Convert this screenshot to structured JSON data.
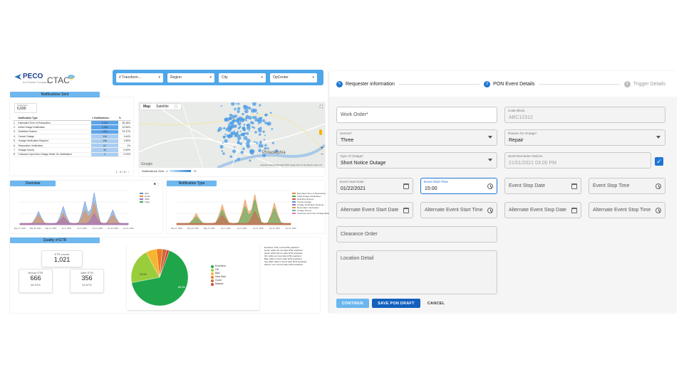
{
  "dashboard": {
    "brand": {
      "peco": "PECO",
      "peco_sub": "An Exelon Company",
      "ctac": "CTAC"
    },
    "filters": [
      "# Transform...",
      "Region",
      "City",
      "OpCenter"
    ],
    "notifications_sent": {
      "title": "Notifications Sent",
      "count_label": "Customers",
      "count_value": "6,690",
      "headers": [
        "",
        "Notification Type",
        "# Notifications ↑",
        "%"
      ],
      "rows": [
        {
          "n": "1.",
          "type": "Estimated Time of Restoration",
          "count": "2,371",
          "pct": "35.48%"
        },
        {
          "n": "2.",
          "type": "Initial Outage Notification",
          "count": "1,515",
          "pct": "22.66%"
        },
        {
          "n": "3.",
          "type": "Definitive Restore",
          "count": "1,571",
          "pct": "23.47%"
        },
        {
          "n": "4.",
          "type": "Cancel Outage",
          "count": "116",
          "pct": "1.64%"
        },
        {
          "n": "5.",
          "type": "Outage Verification Request",
          "count": "106",
          "pct": "1.59%"
        },
        {
          "n": "6.",
          "type": "Restoration Verification",
          "count": "61",
          "pct": "1%"
        },
        {
          "n": "7.",
          "type": "Outage Survey",
          "count": "40",
          "pct": "0.59%"
        },
        {
          "n": "8.",
          "type": "Customer Input Non-Outage Meter On Notification",
          "count": "2",
          "pct": "0.03%"
        }
      ],
      "pager": "1 - 8 / 8"
    },
    "map": {
      "tabs": [
        "Map",
        "Satellite"
      ],
      "legend_label": "Notifications Sent",
      "legend_min": "1",
      "legend_max": "71",
      "place": "Philadelphia",
      "footer": "Keyboard shortcuts   Map data ©2021 Google   Terms of Use   Report a map error"
    },
    "overview": {
      "title": "Overview",
      "legend": [
        "Alert",
        "Email",
        "SMS",
        "Voice"
      ],
      "dates": [
        "May 17, 2020",
        "May 22, 2020",
        "May 27, 2020",
        "Jun 1, 2020",
        "Jun 6, 2020",
        "Jun 11, 2020",
        "Jun 16, 2020",
        "Jun 21, 2020"
      ]
    },
    "notification_type": {
      "title": "Notification Type",
      "legend": [
        "Estimated Time of Restoration",
        "Initial Outage Notification",
        "Definitive Restore",
        "Cancel Outage",
        "Outage Verification Request",
        "Restoration Verification",
        "Outage Survey",
        "Customer Input Non-Outage Meter On Notification"
      ],
      "dates": [
        "May 17, 2020",
        "May 22, 2020",
        "May 27, 2020",
        "Jun 1, 2020",
        "Jun 6, 2020",
        "Jun 11, 2020",
        "Jun 16, 2020",
        "Jun 21, 2020"
      ]
    },
    "etr_quality": {
      "title": "Quality of ETR",
      "etr_count_label": "ETR counts",
      "etr_count": "1,021",
      "before_label": "Before ETR",
      "before_value": "666",
      "before_pct": "65.23%",
      "after_label": "After ETR",
      "after_value": "356",
      "after_pct": "34.87%",
      "pie_labels": [
        "Excellent",
        "OK",
        "Bad",
        "Very Bad",
        "Good",
        "Missed"
      ],
      "pie_colors": [
        "#1fa64a",
        "#9acd3c",
        "#f5b52e",
        "#f07a1f",
        "#c96b3a",
        "#d84532"
      ],
      "pie_text_major": "66.4%",
      "pie_text_second": "20.2%",
      "notes": [
        "Excellent: Prior to the ETR predicted",
        "Great: within 15 min after ETR predicted",
        "Good: within 30 min after ETR predicted",
        "OK: within an hour after ETR predicted",
        "Bad: within 2 hours after ETR predicted",
        "Very Bad: within 4 hours after ETR predicted",
        "Worse: over 4 hours after ETR predicted"
      ]
    }
  },
  "form": {
    "steps": [
      {
        "label": "Requester information",
        "state": "done"
      },
      {
        "label": "PON Event Details",
        "state": "active",
        "num": "2"
      },
      {
        "label": "Trigger Details",
        "state": "inactive",
        "num": "3"
      }
    ],
    "fields": {
      "work_order": {
        "placeholder": "Work Order*"
      },
      "code_block": {
        "label": "Code Block",
        "value": "ABC12312"
      },
      "service": {
        "label": "Service*",
        "value": "Three"
      },
      "reason": {
        "label": "Reason for Outage*",
        "value": "Repair"
      },
      "type_outage": {
        "label": "Type of Outage*",
        "value": "Short Notice Outage"
      },
      "send_reminder": {
        "label": "Send Reminder Notices",
        "value": "21/01/2021 03:00 PM"
      },
      "event_start_date": {
        "label": "Event Start Date",
        "value": "01/22/2021"
      },
      "event_start_time": {
        "label": "Event Start Time",
        "value": "15:00"
      },
      "event_stop_date": {
        "placeholder": "Event Stop Date"
      },
      "event_stop_time": {
        "placeholder": "Event Stop Time"
      },
      "alt_start_date": {
        "placeholder": "Alternate Event Start Date"
      },
      "alt_start_time": {
        "placeholder": "Alternate Event Start Time"
      },
      "alt_stop_date": {
        "placeholder": "Alternate Event Stop Date"
      },
      "alt_stop_time": {
        "placeholder": "Alternate Event Stop Time"
      },
      "clearance_order": {
        "placeholder": "Clearance Order"
      },
      "location_detail": {
        "placeholder": "Location Detail"
      }
    },
    "buttons": {
      "continue": "CONTINUE",
      "save": "SAVE PON DRAFT",
      "cancel": "CANCEL"
    }
  }
}
